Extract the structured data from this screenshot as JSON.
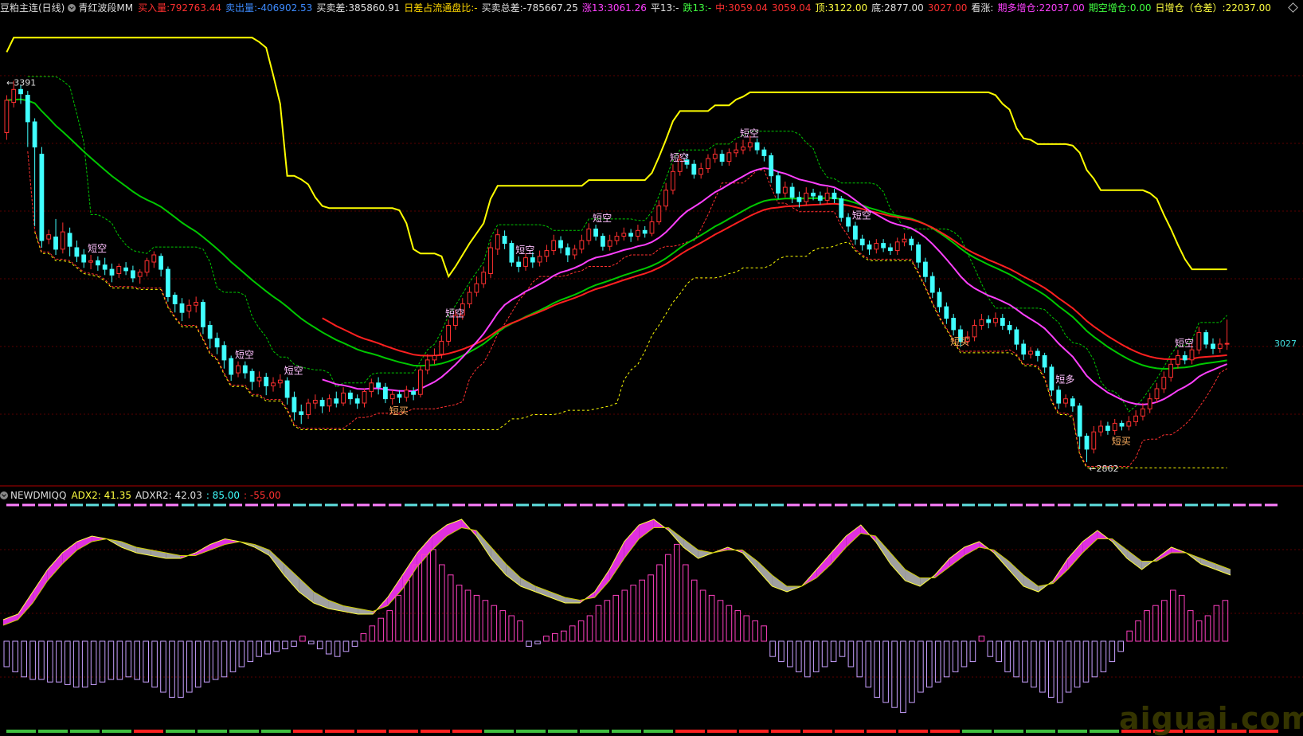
{
  "header": {
    "main_title": "豆粕主连(日线)",
    "indicator_name": "青红波段MM",
    "items": [
      {
        "label": "买入量:",
        "value": "792763.44",
        "color": "#ff3030"
      },
      {
        "label": "卖出量:",
        "value": "-406902.53",
        "color": "#3d8bff"
      },
      {
        "label": "买卖差:",
        "value": "385860.91",
        "color": "#e0e0e0"
      },
      {
        "label": "日差占流通盘比:",
        "value": "-",
        "color": "#ffd700"
      },
      {
        "label": "买卖总差:",
        "value": "-785667.25",
        "color": "#e0e0e0"
      },
      {
        "label": "涨13:",
        "value": "3061.26",
        "color": "#ff40ff"
      },
      {
        "label": "平13:",
        "value": "-",
        "color": "#e0e0e0"
      },
      {
        "label": "跌13:",
        "value": "-",
        "color": "#40ff40"
      },
      {
        "label": "中:",
        "value": "3059.04",
        "color": "#ff3030"
      },
      {
        "label": "",
        "value": "3059.04",
        "color": "#ff3030"
      },
      {
        "label": "顶:",
        "value": "3122.00",
        "color": "#ffff40"
      },
      {
        "label": "底:",
        "value": "2877.00",
        "color": "#e0e0e0"
      },
      {
        "label": "",
        "value": "3027.00",
        "color": "#ff3030"
      },
      {
        "label": "看涨:",
        "value": "",
        "color": "#e0e0e0"
      },
      {
        "label": "期多增仓:",
        "value": "22037.00",
        "color": "#ff40ff"
      },
      {
        "label": "期空增仓:",
        "value": "0.00",
        "color": "#40ff40"
      },
      {
        "label": "日增仓（仓差）:",
        "value": "22037.00",
        "color": "#ffff40"
      }
    ]
  },
  "indicator": {
    "name": "NEWDMIQQ",
    "items": [
      {
        "label": "ADX2:",
        "value": "41.35",
        "color": "#ffff40"
      },
      {
        "label": "ADXR2:",
        "value": "42.03",
        "color": "#e0e0e0"
      },
      {
        "label": ":",
        "value": "85.00",
        "color": "#40ffff"
      },
      {
        "label": ":",
        "value": "-55.00",
        "color": "#ff3030"
      }
    ]
  },
  "watermark": "aiguai.com",
  "colors": {
    "up": "#ff3030",
    "down": "#40ffff",
    "yellow": "#ffff00",
    "green": "#00c800",
    "magenta": "#ff40ff",
    "red_ma": "#ff2020"
  },
  "chart_data": {
    "type": "candlestick",
    "ylim": [
      2840,
      3480
    ],
    "candles": [
      [
        3320,
        3365,
        3372,
        3310
      ],
      [
        3362,
        3380,
        3392,
        3355
      ],
      [
        3380,
        3374,
        3386,
        3360
      ],
      [
        3372,
        3335,
        3378,
        3300
      ],
      [
        3335,
        3300,
        3340,
        3190
      ],
      [
        3290,
        3170,
        3300,
        3160
      ],
      [
        3172,
        3178,
        3185,
        3165
      ],
      [
        3175,
        3158,
        3200,
        3150
      ],
      [
        3158,
        3182,
        3195,
        3152
      ],
      [
        3180,
        3162,
        3188,
        3148
      ],
      [
        3160,
        3148,
        3170,
        3140
      ],
      [
        3150,
        3140,
        3158,
        3132
      ],
      [
        3140,
        3142,
        3150,
        3130
      ],
      [
        3142,
        3136,
        3148,
        3128
      ],
      [
        3136,
        3130,
        3146,
        3122
      ],
      [
        3130,
        3122,
        3138,
        3112
      ],
      [
        3124,
        3134,
        3138,
        3118
      ],
      [
        3132,
        3128,
        3140,
        3122
      ],
      [
        3128,
        3118,
        3135,
        3112
      ],
      [
        3120,
        3126,
        3130,
        3110
      ],
      [
        3126,
        3142,
        3146,
        3120
      ],
      [
        3140,
        3150,
        3155,
        3132
      ],
      [
        3148,
        3130,
        3152,
        3120
      ],
      [
        3130,
        3092,
        3134,
        3085
      ],
      [
        3094,
        3082,
        3098,
        3070
      ],
      [
        3082,
        3070,
        3090,
        3058
      ],
      [
        3072,
        3080,
        3088,
        3062
      ],
      [
        3080,
        3084,
        3092,
        3070
      ],
      [
        3084,
        3050,
        3088,
        3040
      ],
      [
        3052,
        3034,
        3058,
        3020
      ],
      [
        3034,
        3022,
        3042,
        3012
      ],
      [
        3024,
        3004,
        3030,
        2992
      ],
      [
        3006,
        2984,
        3010,
        2975
      ],
      [
        2986,
        2996,
        3002,
        2980
      ],
      [
        2996,
        2986,
        3002,
        2978
      ],
      [
        2988,
        2974,
        2992,
        2962
      ],
      [
        2975,
        2980,
        2988,
        2966
      ],
      [
        2980,
        2968,
        2986,
        2955
      ],
      [
        2968,
        2972,
        2980,
        2960
      ],
      [
        2972,
        2976,
        2984,
        2965
      ],
      [
        2975,
        2952,
        2980,
        2942
      ],
      [
        2952,
        2932,
        2960,
        2920
      ],
      [
        2932,
        2928,
        2942,
        2915
      ],
      [
        2928,
        2944,
        2950,
        2922
      ],
      [
        2944,
        2948,
        2956,
        2936
      ],
      [
        2948,
        2940,
        2952,
        2930
      ],
      [
        2940,
        2950,
        2956,
        2932
      ],
      [
        2950,
        2944,
        2960,
        2938
      ],
      [
        2944,
        2958,
        2966,
        2940
      ],
      [
        2958,
        2950,
        2962,
        2942
      ],
      [
        2950,
        2944,
        2956,
        2936
      ],
      [
        2944,
        2960,
        2964,
        2938
      ],
      [
        2960,
        2972,
        2978,
        2952
      ],
      [
        2972,
        2966,
        2980,
        2956
      ],
      [
        2966,
        2950,
        2972,
        2944
      ],
      [
        2950,
        2956,
        2962,
        2942
      ],
      [
        2956,
        2952,
        2962,
        2944
      ],
      [
        2952,
        2962,
        2968,
        2946
      ],
      [
        2960,
        2956,
        2966,
        2948
      ],
      [
        2956,
        2990,
        2996,
        2952
      ],
      [
        2990,
        3004,
        3012,
        2984
      ],
      [
        3004,
        3010,
        3020,
        2998
      ],
      [
        3012,
        3030,
        3038,
        3006
      ],
      [
        3030,
        3052,
        3060,
        3024
      ],
      [
        3052,
        3066,
        3074,
        3046
      ],
      [
        3066,
        3082,
        3090,
        3060
      ],
      [
        3082,
        3098,
        3106,
        3076
      ],
      [
        3098,
        3110,
        3120,
        3092
      ],
      [
        3110,
        3126,
        3134,
        3104
      ],
      [
        3124,
        3160,
        3168,
        3118
      ],
      [
        3158,
        3178,
        3186,
        3150
      ],
      [
        3176,
        3166,
        3184,
        3158
      ],
      [
        3166,
        3140,
        3170,
        3134
      ],
      [
        3140,
        3134,
        3148,
        3126
      ],
      [
        3134,
        3146,
        3152,
        3128
      ],
      [
        3146,
        3140,
        3154,
        3132
      ],
      [
        3140,
        3148,
        3156,
        3134
      ],
      [
        3148,
        3156,
        3164,
        3140
      ],
      [
        3156,
        3170,
        3178,
        3150
      ],
      [
        3170,
        3160,
        3176,
        3152
      ],
      [
        3160,
        3150,
        3166,
        3140
      ],
      [
        3150,
        3158,
        3164,
        3144
      ],
      [
        3158,
        3170,
        3178,
        3152
      ],
      [
        3170,
        3186,
        3194,
        3164
      ],
      [
        3186,
        3176,
        3192,
        3170
      ],
      [
        3176,
        3162,
        3180,
        3156
      ],
      [
        3162,
        3170,
        3178,
        3156
      ],
      [
        3170,
        3176,
        3182,
        3164
      ],
      [
        3176,
        3180,
        3188,
        3170
      ],
      [
        3180,
        3176,
        3186,
        3168
      ],
      [
        3176,
        3184,
        3192,
        3170
      ],
      [
        3184,
        3180,
        3190,
        3174
      ],
      [
        3180,
        3196,
        3204,
        3176
      ],
      [
        3196,
        3218,
        3226,
        3192
      ],
      [
        3218,
        3240,
        3250,
        3212
      ],
      [
        3240,
        3266,
        3276,
        3234
      ],
      [
        3266,
        3282,
        3290,
        3260
      ],
      [
        3282,
        3276,
        3290,
        3270
      ],
      [
        3276,
        3262,
        3282,
        3256
      ],
      [
        3262,
        3270,
        3278,
        3256
      ],
      [
        3270,
        3284,
        3290,
        3264
      ],
      [
        3284,
        3290,
        3298,
        3278
      ],
      [
        3290,
        3280,
        3296,
        3274
      ],
      [
        3280,
        3292,
        3298,
        3274
      ],
      [
        3292,
        3296,
        3306,
        3286
      ],
      [
        3296,
        3300,
        3310,
        3290
      ],
      [
        3300,
        3306,
        3316,
        3294
      ],
      [
        3306,
        3296,
        3312,
        3290
      ],
      [
        3296,
        3288,
        3300,
        3280
      ],
      [
        3288,
        3260,
        3292,
        3250
      ],
      [
        3260,
        3236,
        3266,
        3228
      ],
      [
        3236,
        3244,
        3252,
        3230
      ],
      [
        3244,
        3230,
        3250,
        3222
      ],
      [
        3230,
        3224,
        3238,
        3216
      ],
      [
        3224,
        3236,
        3244,
        3218
      ],
      [
        3236,
        3232,
        3242,
        3226
      ],
      [
        3232,
        3226,
        3238,
        3220
      ],
      [
        3226,
        3236,
        3244,
        3220
      ],
      [
        3236,
        3228,
        3242,
        3222
      ],
      [
        3228,
        3202,
        3232,
        3196
      ],
      [
        3202,
        3190,
        3208,
        3182
      ],
      [
        3190,
        3172,
        3196,
        3164
      ],
      [
        3172,
        3164,
        3178,
        3156
      ],
      [
        3164,
        3158,
        3170,
        3150
      ],
      [
        3158,
        3166,
        3172,
        3152
      ],
      [
        3166,
        3160,
        3172,
        3154
      ],
      [
        3160,
        3156,
        3166,
        3150
      ],
      [
        3156,
        3168,
        3174,
        3150
      ],
      [
        3168,
        3172,
        3180,
        3162
      ],
      [
        3172,
        3164,
        3176,
        3156
      ],
      [
        3164,
        3140,
        3168,
        3132
      ],
      [
        3140,
        3120,
        3146,
        3112
      ],
      [
        3120,
        3098,
        3126,
        3090
      ],
      [
        3098,
        3078,
        3104,
        3070
      ],
      [
        3078,
        3062,
        3084,
        3054
      ],
      [
        3062,
        3046,
        3068,
        3038
      ],
      [
        3046,
        3030,
        3052,
        3022
      ],
      [
        3030,
        3036,
        3044,
        3024
      ],
      [
        3036,
        3052,
        3060,
        3030
      ],
      [
        3052,
        3060,
        3068,
        3046
      ],
      [
        3060,
        3056,
        3066,
        3048
      ],
      [
        3056,
        3062,
        3070,
        3050
      ],
      [
        3062,
        3052,
        3068,
        3046
      ],
      [
        3052,
        3046,
        3058,
        3040
      ],
      [
        3046,
        3026,
        3050,
        3018
      ],
      [
        3026,
        3012,
        3032,
        3004
      ],
      [
        3012,
        3016,
        3022,
        3006
      ],
      [
        3016,
        3010,
        3020,
        3002
      ],
      [
        3010,
        2994,
        3014,
        2986
      ],
      [
        2994,
        2962,
        2998,
        2954
      ],
      [
        2962,
        2944,
        2968,
        2936
      ],
      [
        2944,
        2950,
        2956,
        2938
      ],
      [
        2950,
        2940,
        2954,
        2932
      ],
      [
        2940,
        2898,
        2944,
        2880
      ],
      [
        2898,
        2880,
        2902,
        2862
      ],
      [
        2880,
        2904,
        2912,
        2874
      ],
      [
        2904,
        2912,
        2920,
        2898
      ],
      [
        2912,
        2906,
        2918,
        2900
      ],
      [
        2906,
        2916,
        2922,
        2900
      ],
      [
        2916,
        2912,
        2920,
        2906
      ],
      [
        2912,
        2918,
        2926,
        2906
      ],
      [
        2918,
        2926,
        2934,
        2912
      ],
      [
        2926,
        2936,
        2944,
        2920
      ],
      [
        2936,
        2950,
        2958,
        2930
      ],
      [
        2950,
        2964,
        2972,
        2944
      ],
      [
        2964,
        2980,
        2988,
        2958
      ],
      [
        2980,
        2998,
        3006,
        2974
      ],
      [
        2998,
        3010,
        3018,
        2992
      ],
      [
        3010,
        3004,
        3016,
        2998
      ],
      [
        3004,
        3018,
        3026,
        2998
      ],
      [
        3018,
        3042,
        3050,
        3012
      ],
      [
        3042,
        3026,
        3046,
        3020
      ],
      [
        3026,
        3020,
        3034,
        3012
      ],
      [
        3020,
        3026,
        3034,
        3014
      ],
      [
        3026,
        3027,
        3060,
        3018
      ]
    ],
    "price_labels": [
      "3391",
      "3027",
      "2862"
    ],
    "signal_labels": [
      "短空",
      "短买",
      "短多"
    ],
    "adx_series": [
      {
        "name": "ADX2",
        "values": [
          12,
          14,
          22,
          30,
          36,
          40,
          42,
          41,
          38,
          36,
          35,
          34,
          34,
          36,
          39,
          41,
          40,
          38,
          35,
          28,
          22,
          18,
          16,
          15,
          14,
          14,
          20,
          28,
          36,
          42,
          46,
          48,
          42,
          34,
          28,
          24,
          22,
          20,
          18,
          18,
          22,
          30,
          40,
          46,
          48,
          44,
          38,
          34,
          36,
          38,
          36,
          30,
          24,
          22,
          24,
          30,
          36,
          42,
          46,
          40,
          32,
          26,
          24,
          28,
          34,
          38,
          40,
          36,
          30,
          24,
          22,
          26,
          34,
          40,
          44,
          40,
          34,
          30,
          34,
          38,
          36,
          32,
          30,
          28
        ]
      },
      {
        "name": "ADXR2",
        "values": [
          10,
          12,
          18,
          26,
          32,
          37,
          40,
          41,
          40,
          38,
          37,
          36,
          35,
          35,
          37,
          39,
          40,
          39,
          37,
          32,
          27,
          22,
          19,
          17,
          16,
          15,
          17,
          23,
          31,
          37,
          42,
          45,
          44,
          38,
          32,
          27,
          24,
          22,
          20,
          19,
          20,
          26,
          34,
          41,
          45,
          45,
          41,
          37,
          36,
          37,
          37,
          33,
          28,
          24,
          24,
          27,
          32,
          38,
          43,
          42,
          36,
          30,
          27,
          27,
          31,
          35,
          38,
          37,
          33,
          28,
          24,
          25,
          30,
          36,
          41,
          41,
          37,
          33,
          33,
          36,
          36,
          34,
          32,
          30
        ]
      }
    ],
    "histogram": [
      -10,
      -12,
      -14,
      -15,
      -15,
      -16,
      -16,
      -17,
      -18,
      -18,
      -17,
      -16,
      -15,
      -15,
      -14,
      -15,
      -16,
      -18,
      -20,
      -22,
      -22,
      -20,
      -18,
      -16,
      -15,
      -14,
      -12,
      -10,
      -8,
      -6,
      -5,
      -4,
      -3,
      -2,
      2,
      -1,
      -3,
      -5,
      -6,
      -4,
      -2,
      3,
      6,
      9,
      12,
      18,
      24,
      30,
      34,
      36,
      30,
      26,
      22,
      20,
      18,
      16,
      14,
      12,
      10,
      8,
      -2,
      -1,
      2,
      3,
      4,
      6,
      8,
      10,
      14,
      16,
      18,
      20,
      22,
      24,
      26,
      30,
      34,
      38,
      30,
      24,
      20,
      18,
      16,
      14,
      12,
      10,
      8,
      6,
      -6,
      -8,
      -10,
      -12,
      -14,
      -12,
      -10,
      -8,
      -6,
      -10,
      -14,
      -18,
      -22,
      -24,
      -26,
      -28,
      -24,
      -20,
      -18,
      -16,
      -14,
      -12,
      -10,
      -8,
      2,
      -6,
      -8,
      -12,
      -14,
      -16,
      -18,
      -20,
      -22,
      -24,
      -20,
      -18,
      -16,
      -14,
      -12,
      -8,
      -4,
      4,
      8,
      12,
      14,
      16,
      20,
      18,
      12,
      8,
      10,
      14,
      16
    ]
  }
}
